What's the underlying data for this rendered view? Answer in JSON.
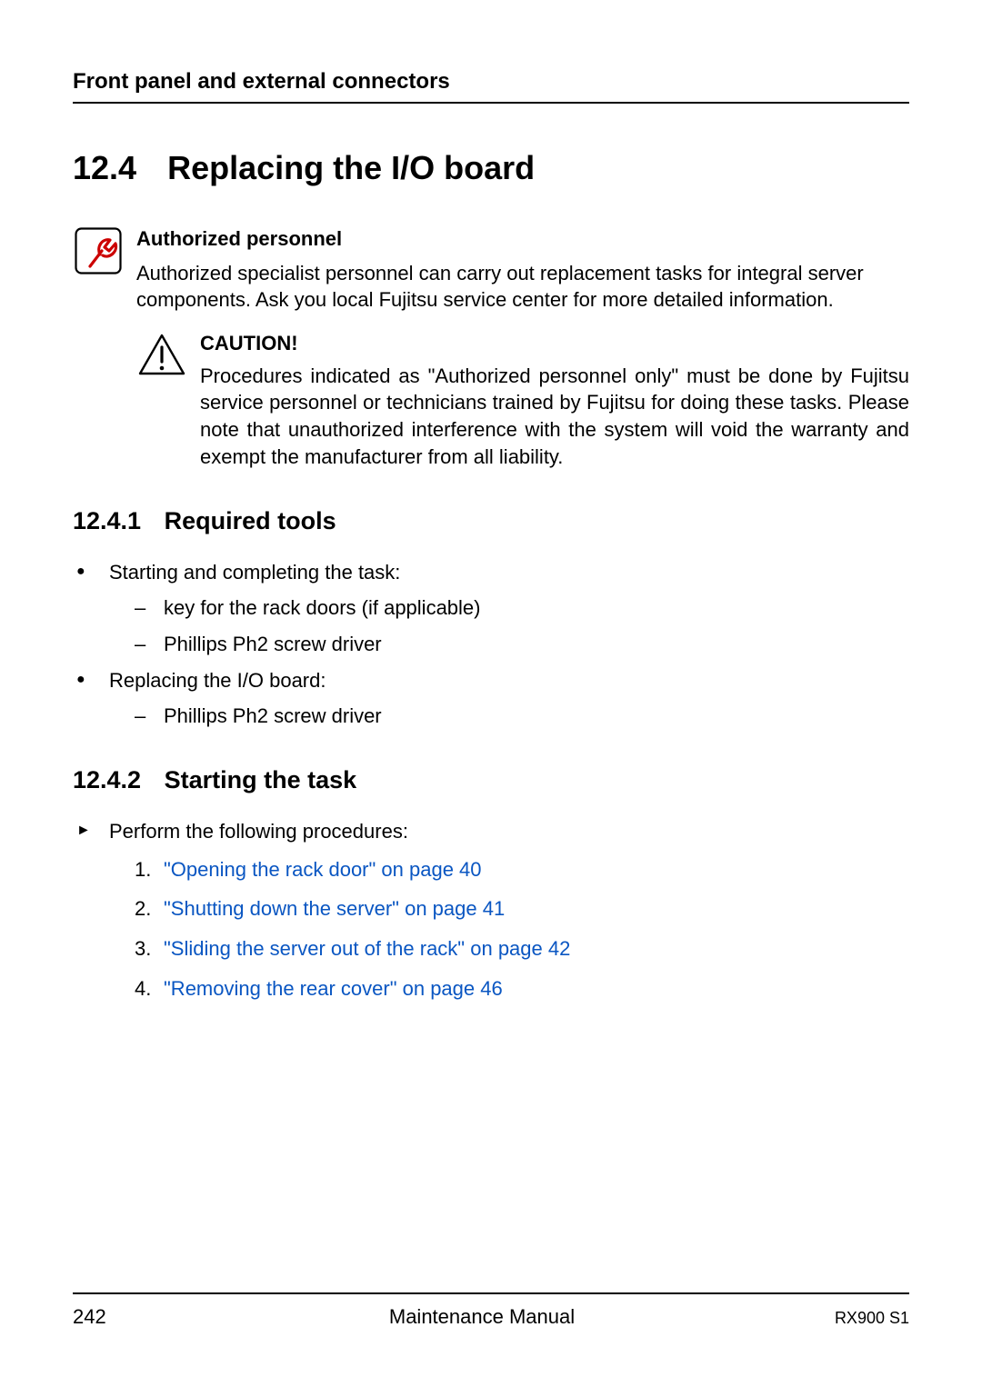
{
  "header": {
    "running_head": "Front panel and external connectors"
  },
  "section": {
    "number": "12.4",
    "title": "Replacing the I/O board"
  },
  "authorized": {
    "title": "Authorized personnel",
    "body": "Authorized specialist personnel can carry out replacement tasks for integral server components. Ask you local Fujitsu service center for more detailed information."
  },
  "caution": {
    "title": "CAUTION!",
    "body": "Procedures indicated as \"Authorized personnel only\" must be done by Fujitsu service personnel or technicians trained by Fujitsu for doing these tasks. Please note that unauthorized interference with the system will void the warranty and exempt the manufacturer from all liability."
  },
  "sub1": {
    "number": "12.4.1",
    "title": "Required tools",
    "items": [
      {
        "lead": "Starting and completing the task:",
        "subs": [
          "key for the rack doors (if applicable)",
          "Phillips Ph2 screw driver"
        ]
      },
      {
        "lead": "Replacing the I/O board:",
        "subs": [
          "Phillips Ph2 screw driver"
        ]
      }
    ]
  },
  "sub2": {
    "number": "12.4.2",
    "title": "Starting the task",
    "lead": "Perform the following procedures:",
    "steps": [
      "\"Opening the rack door\" on page 40",
      "\"Shutting down the server\" on page 41",
      "\"Sliding the server out of the rack\" on page 42",
      "\"Removing the rear cover\" on page 46"
    ]
  },
  "footer": {
    "page": "242",
    "center": "Maintenance Manual",
    "model": "RX900 S1"
  }
}
